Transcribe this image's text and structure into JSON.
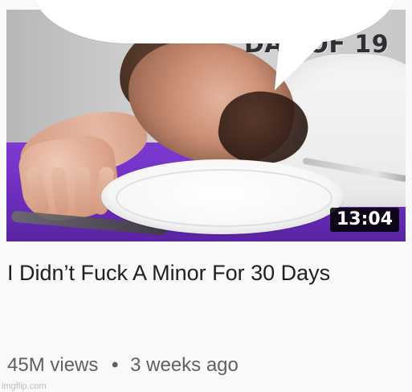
{
  "video": {
    "thumbnail_overlay": "DAY OF 19",
    "duration": "13:04",
    "title": "I Didn’t Fuck A Minor For 30 Days",
    "views": "45M views",
    "separator": "•",
    "age": "3 weeks ago"
  },
  "footer": {
    "watermark": "imgflip.com"
  },
  "icons": {
    "more": "dot-separator"
  }
}
